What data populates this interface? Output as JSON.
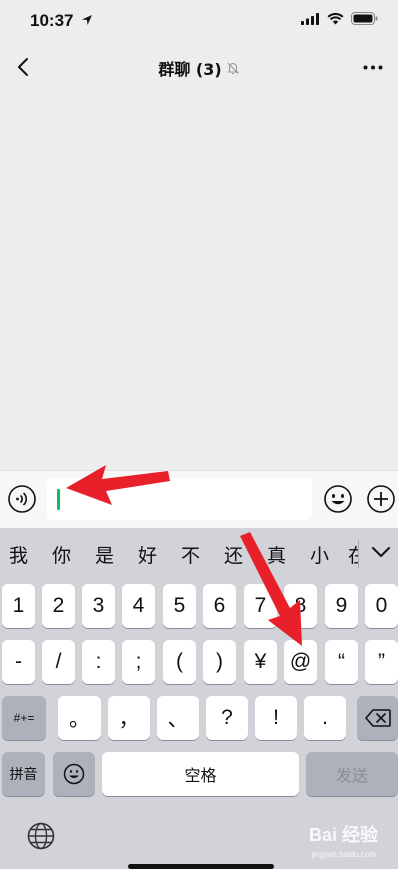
{
  "status": {
    "time": "10:37"
  },
  "nav": {
    "title": "群聊 (3)"
  },
  "input": {
    "value": ""
  },
  "keyboard": {
    "candidates": [
      "我",
      "你",
      "是",
      "好",
      "不",
      "还",
      "真",
      "小",
      "在"
    ],
    "row1": [
      "1",
      "2",
      "3",
      "4",
      "5",
      "6",
      "7",
      "8",
      "9",
      "0"
    ],
    "row2": [
      "-",
      "/",
      ":",
      ";",
      "(",
      ")",
      "¥",
      "@",
      "“",
      "”"
    ],
    "row3": [
      "。",
      "，",
      "、",
      "?",
      "!",
      "."
    ],
    "shift_label": "#+=",
    "pinyin_label": "拼音",
    "space_label": "空格",
    "send_label": "发送"
  },
  "watermark": {
    "brand": "Bai 经验",
    "url": "jingyan.baidu.com"
  }
}
